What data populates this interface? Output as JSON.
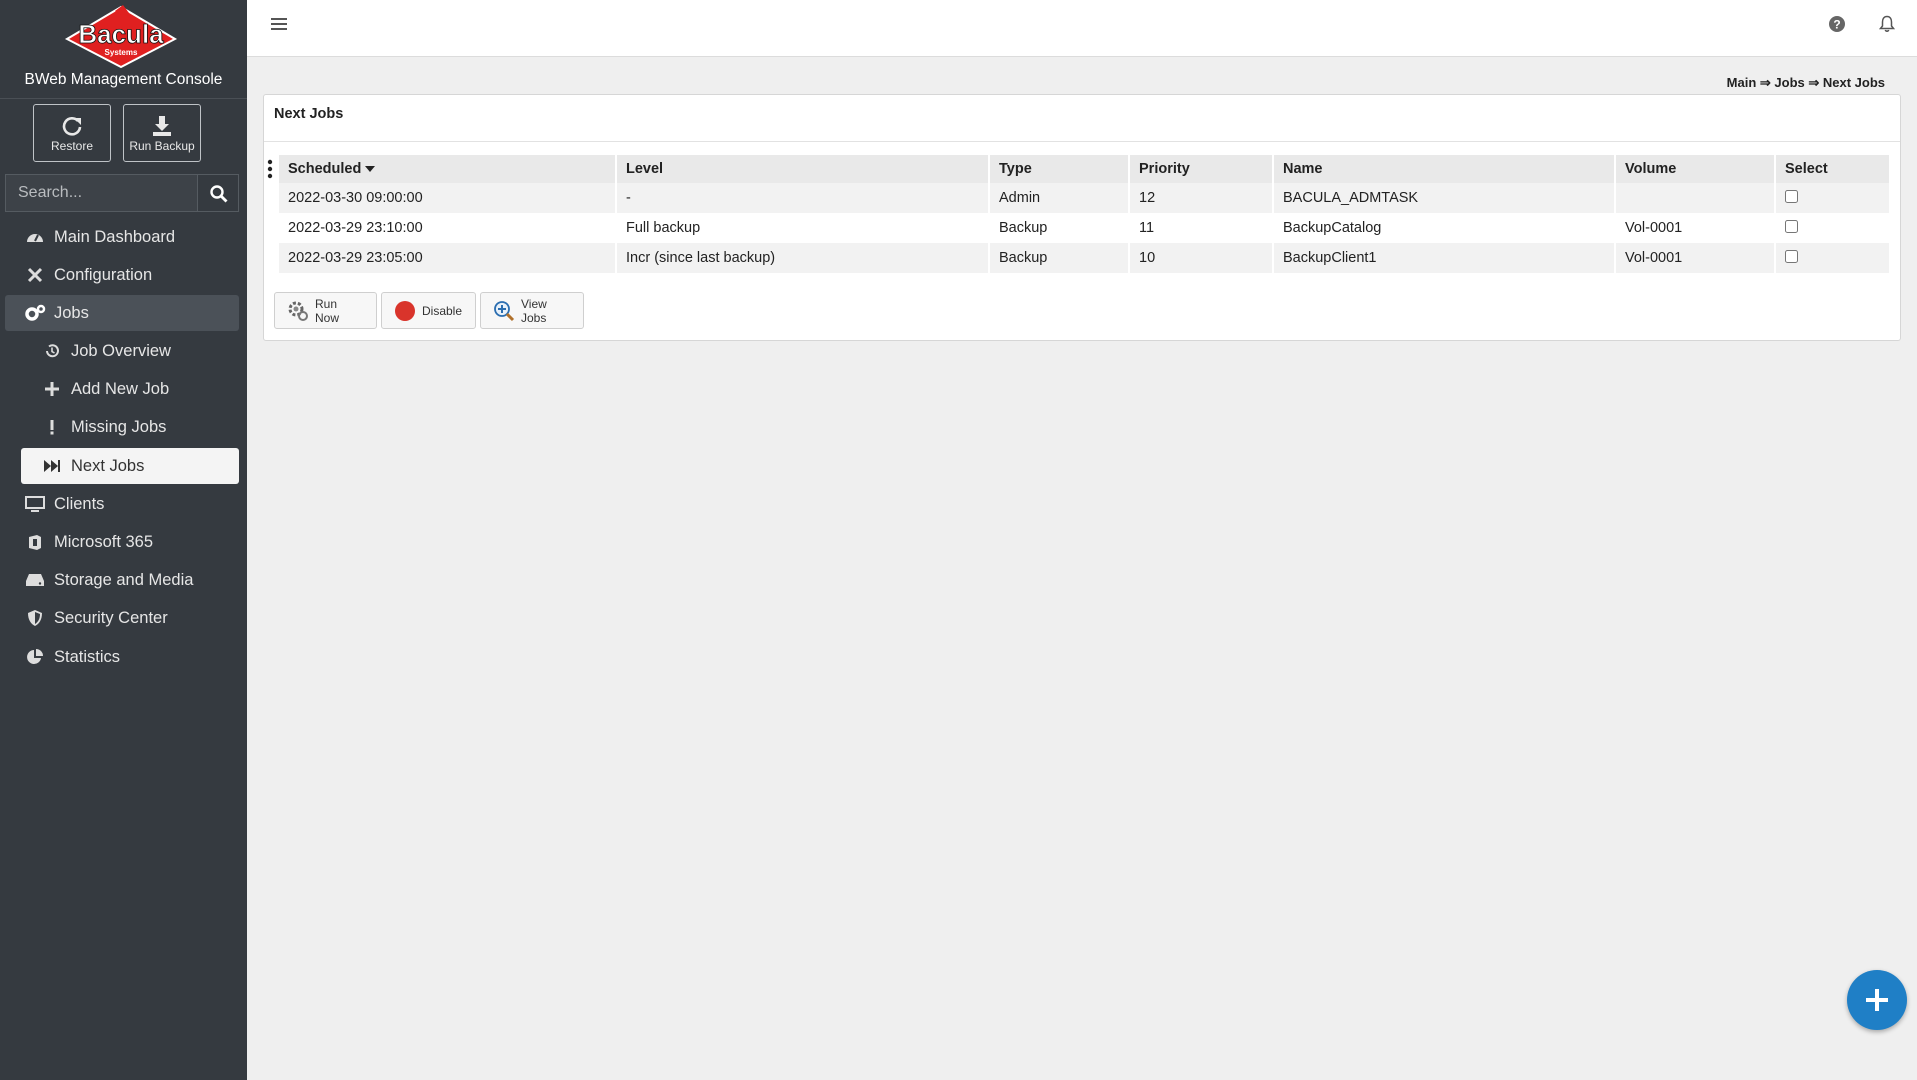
{
  "sidebar": {
    "logo_text": "Bacula",
    "logo_subtext": "Systems",
    "console_title": "BWeb Management Console",
    "quick_actions": [
      {
        "label": "Restore",
        "icon": "refresh-icon"
      },
      {
        "label": "Run Backup",
        "icon": "download-icon"
      }
    ],
    "search": {
      "placeholder": "Search..."
    },
    "nav": [
      {
        "label": "Main Dashboard",
        "icon": "dashboard-icon"
      },
      {
        "label": "Configuration",
        "icon": "tools-icon"
      },
      {
        "label": "Jobs",
        "icon": "gears-icon",
        "active": true
      },
      {
        "label": "Job Overview",
        "icon": "history-icon"
      },
      {
        "label": "Add New Job",
        "icon": "plus-icon"
      },
      {
        "label": "Missing Jobs",
        "icon": "exclamation-icon"
      },
      {
        "label": "Next Jobs",
        "icon": "fast-forward-icon",
        "current": true
      },
      {
        "label": "Clients",
        "icon": "monitor-icon"
      },
      {
        "label": "Microsoft 365",
        "icon": "office-icon"
      },
      {
        "label": "Storage and Media",
        "icon": "hdd-icon"
      },
      {
        "label": "Security Center",
        "icon": "shield-icon"
      },
      {
        "label": "Statistics",
        "icon": "pie-chart-icon"
      }
    ]
  },
  "header": {
    "breadcrumb": "Main ⇒ Jobs ⇒ Next Jobs"
  },
  "card": {
    "title": "Next Jobs",
    "columns": [
      "Scheduled",
      "Level",
      "Type",
      "Priority",
      "Name",
      "Volume",
      "Select"
    ],
    "sort_column": "Scheduled",
    "rows": [
      {
        "scheduled": "2022-03-30 09:00:00",
        "level": "-",
        "type": "Admin",
        "priority": "12",
        "name": "BACULA_ADMTASK",
        "volume": "",
        "selected": false
      },
      {
        "scheduled": "2022-03-29 23:10:00",
        "level": "Full backup",
        "type": "Backup",
        "priority": "11",
        "name": "BackupCatalog",
        "volume": "Vol-0001",
        "selected": false
      },
      {
        "scheduled": "2022-03-29 23:05:00",
        "level": "Incr (since last backup)",
        "type": "Backup",
        "priority": "10",
        "name": "BackupClient1",
        "volume": "Vol-0001",
        "selected": false
      }
    ],
    "actions": [
      {
        "label": "Run Now",
        "icon": "gear-run-icon"
      },
      {
        "label": "Disable",
        "icon": "red-circle-icon"
      },
      {
        "label": "View Jobs",
        "icon": "zoom-icon"
      }
    ]
  },
  "colors": {
    "sidebar_bg": "#353a40",
    "accent": "#1f7fc6",
    "disable_red": "#d9342b"
  }
}
